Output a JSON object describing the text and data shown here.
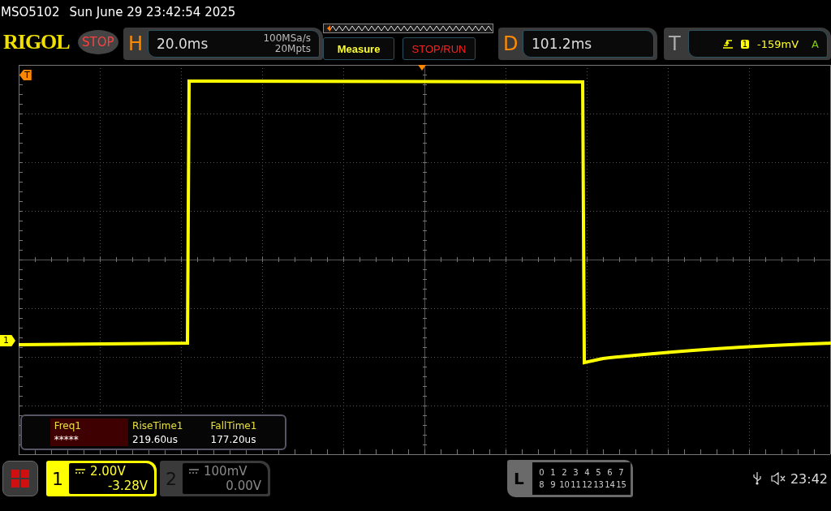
{
  "status_line": {
    "model": "MSO5102",
    "datetime": "Sun June 29 23:42:54 2025"
  },
  "header": {
    "logo": "RIGOL",
    "run_state": "STOP",
    "horizontal": {
      "letter": "H",
      "timebase": "20.0ms",
      "sample_rate": "100MSa/s",
      "memory_depth": "20Mpts"
    },
    "buttons": [
      {
        "label": "Measure",
        "kind": "menu"
      },
      {
        "label": "STOP/RUN",
        "kind": "run"
      }
    ],
    "delay": {
      "letter": "D",
      "value": "101.2ms"
    },
    "trigger": {
      "letter": "T",
      "source": "1",
      "level": "-159mV",
      "mode": "A"
    }
  },
  "screen": {
    "trigger_marker": "T",
    "channel_marker": "1"
  },
  "measurements": [
    {
      "label": "Freq1",
      "value": "*****",
      "selected": true
    },
    {
      "label": "RiseTime1",
      "value": "219.60us",
      "selected": false
    },
    {
      "label": "FallTime1",
      "value": "177.20us",
      "selected": false
    }
  ],
  "channels": [
    {
      "number": "1",
      "scale": "2.00V",
      "offset": "-3.28V",
      "active": true
    },
    {
      "number": "2",
      "scale": "100mV",
      "offset": "0.00V",
      "active": false
    }
  ],
  "logic": {
    "letter": "L",
    "rows": [
      [
        "0",
        "1",
        "2",
        "3",
        "4",
        "5",
        "6",
        "7"
      ],
      [
        "8",
        "9",
        "10",
        "11",
        "12",
        "13",
        "14",
        "15"
      ]
    ]
  },
  "status_bar": {
    "time": "23:42"
  }
}
